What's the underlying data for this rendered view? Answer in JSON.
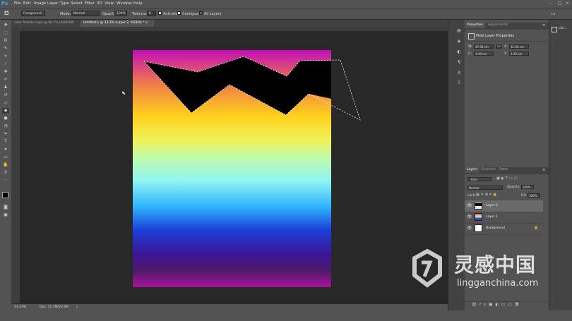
{
  "menubar": {
    "logo": "Ps",
    "items": [
      "File",
      "Edit",
      "Image",
      "Layer",
      "Type",
      "Select",
      "Filter",
      "3D",
      "View",
      "Window",
      "Help"
    ],
    "window_controls": [
      "–",
      "□",
      "×"
    ]
  },
  "options": {
    "fill_source": "Foreground",
    "mode_label": "Mode:",
    "mode_value": "Normal",
    "opacity_label": "Opacity:",
    "opacity_value": "100%",
    "tolerance_label": "Tolerance:",
    "tolerance_value": "0",
    "antialias_label": "Anti-alias",
    "contiguous_label": "Contiguous",
    "all_layers_label": "All Layers"
  },
  "tabs": [
    {
      "label": "color Palette Copy @ 66.7% (RGB/8#) ×"
    },
    {
      "label": "Untitled-1 @ 33.3% (Layer 2, RGB/8) * ×"
    }
  ],
  "status": {
    "zoom": "33.33%",
    "doc": "Doc: 11.7M/23.0M"
  },
  "properties": {
    "tabs": [
      "Properties",
      "Adjustments"
    ],
    "title": "Pixel Layer Properties",
    "w_label": "W:",
    "w_value": "47.06 cm",
    "go_label": "GO",
    "x_label": "X:",
    "x_value": "11.40 cm",
    "h_label": "H:",
    "h_value": "3.49 cm",
    "y_label": "Y:",
    "y_value": "1.22 cm"
  },
  "layers": {
    "tabs": [
      "Layers",
      "Channels",
      "Paths"
    ],
    "filter_kind": "Kind",
    "blend_mode": "Normal",
    "opacity_label": "Opacity:",
    "opacity_value": "100%",
    "lock_label": "Lock:",
    "fill_label": "Fill:",
    "fill_value": "100%",
    "items": [
      {
        "name": "Layer 2",
        "selected": true
      },
      {
        "name": "Layer 1",
        "selected": false
      },
      {
        "name": "Background",
        "selected": false
      }
    ]
  },
  "farright": {
    "label": "Libr..."
  },
  "watermark": {
    "brand": "灵感中国",
    "url": "lingganchina.com"
  },
  "colors": {
    "accent": "#31a8ff",
    "panel": "#535353",
    "workspace": "#282828"
  }
}
